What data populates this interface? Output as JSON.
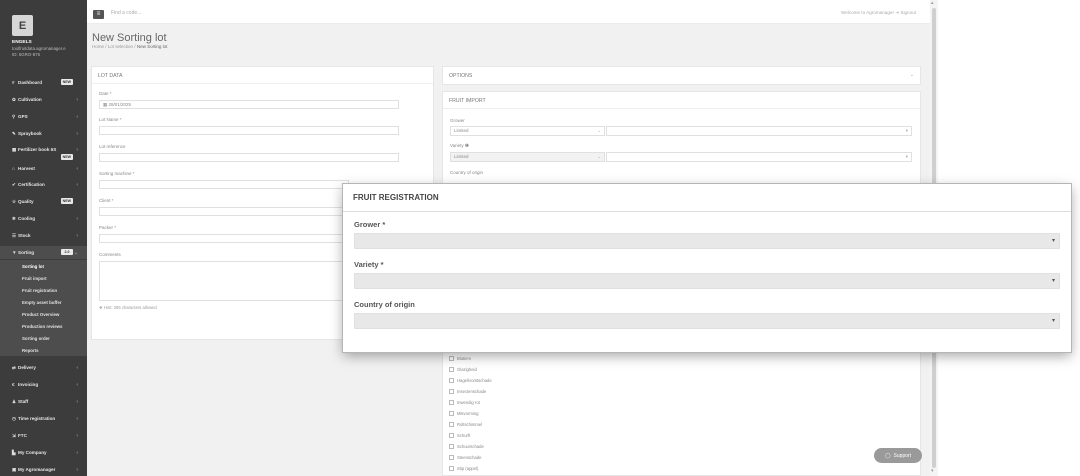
{
  "sidebar": {
    "logo_letter": "E",
    "user": {
      "name": "ENGELS",
      "email": "toolfruitdata.agromanager.e",
      "id": "ID: 6GRO-875"
    },
    "items": [
      {
        "label": "Dashboard",
        "icon": "#",
        "badge": "NEW"
      },
      {
        "label": "Cultivation",
        "icon": "✿"
      },
      {
        "label": "GPS",
        "icon": "⚲"
      },
      {
        "label": "Spraybook",
        "icon": "✎"
      },
      {
        "label": "Fertilizer book 6S",
        "icon": "▦",
        "badge": "NEW"
      },
      {
        "label": "Harvest",
        "icon": "⌂"
      },
      {
        "label": "Certification",
        "icon": "✔"
      },
      {
        "label": "Quality",
        "icon": "☆",
        "badge": "NEW"
      },
      {
        "label": "Cooling",
        "icon": "❄"
      },
      {
        "label": "Stock",
        "icon": "☰"
      },
      {
        "label": "Sorting",
        "icon": "▼",
        "badge": "2.0"
      },
      {
        "label": "Delivery",
        "icon": "⇄"
      },
      {
        "label": "Invoicing",
        "icon": "€"
      },
      {
        "label": "Staff",
        "icon": "♟"
      },
      {
        "label": "Time registration",
        "icon": "◷"
      },
      {
        "label": "FTC",
        "icon": "⇲"
      },
      {
        "label": "My Company",
        "icon": "▙"
      },
      {
        "label": "My Agromanager",
        "icon": "▣"
      }
    ],
    "sorting_sub": [
      "Sorting lot",
      "Fruit import",
      "Fruit registration",
      "Empty asset buffer",
      "Product Overview",
      "Production reviews",
      "Sorting order",
      "Reports"
    ]
  },
  "topbar": {
    "menu_icon": "≡",
    "find_placeholder": "Find a code...",
    "welcome": "Welcome to Agromanager",
    "signout": "Signout"
  },
  "page": {
    "title": "New Sorting lot",
    "crumb_home": "Home",
    "crumb_lot": "Lot selection",
    "crumb_current": "New Sorting lot"
  },
  "lot_data": {
    "header": "LOT DATA",
    "date_label": "Date *",
    "date_value": "28/01/2025",
    "lot_name_label": "Lot Name *",
    "lot_ref_label": "Lot reference",
    "sorting_machine_label": "Sorting machine *",
    "client_label": "Client *",
    "packer_label": "Packer *",
    "comments_label": "Comments",
    "hint": "Hint: 255 characters allowed"
  },
  "options": {
    "header": "OPTIONS"
  },
  "fruit_import": {
    "header": "FRUIT IMPORT",
    "grower_label": "Grower",
    "grower_value": "Limited",
    "variety_label": "Variety ❶",
    "variety_value": "Limited",
    "country_label": "Country of origin",
    "checkboxes": [
      "Blutiem",
      "Glazigheid",
      "Hagel/vorstschade",
      "Insectenschade",
      "Inwendig rot",
      "Misvorming",
      "Roltschimmel",
      "Schurft",
      "Schuurschade",
      "Steenschade",
      "Stip (appel)"
    ]
  },
  "modal": {
    "title": "FRUIT REGISTRATION",
    "grower_label": "Grower *",
    "variety_label": "Variety *",
    "country_label": "Country of origin"
  },
  "support": {
    "label": "Support"
  }
}
